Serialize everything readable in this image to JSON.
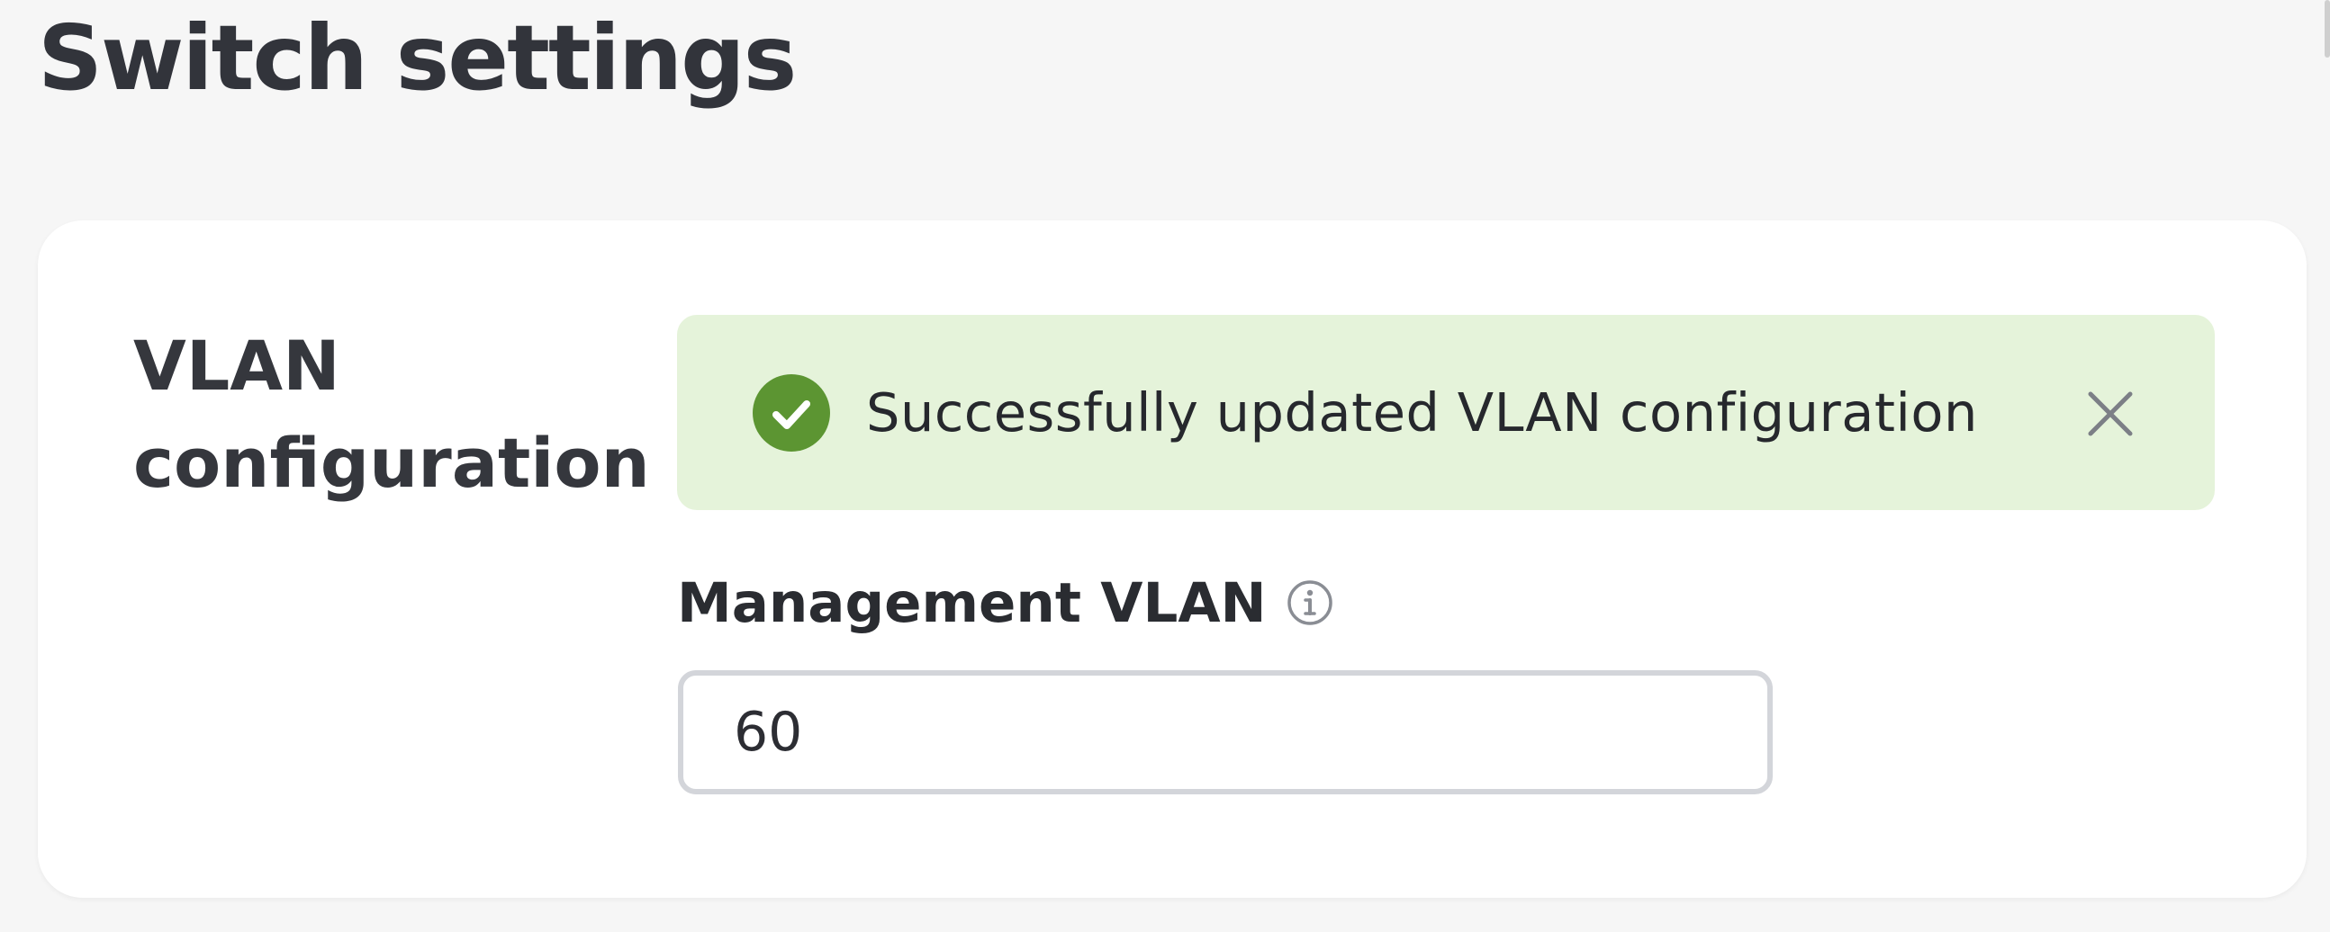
{
  "page": {
    "title": "Switch settings"
  },
  "section": {
    "title": "VLAN configuration"
  },
  "alert": {
    "type": "success",
    "message": "Successfully updated VLAN configuration",
    "icon": "check-circle-icon",
    "dismiss_icon": "close-icon"
  },
  "management_vlan": {
    "label": "Management VLAN",
    "info_icon": "info-icon",
    "value": "60"
  },
  "colors": {
    "background": "#f6f6f6",
    "card": "#ffffff",
    "alert_background": "#e5f3da",
    "success_green": "#5c9532",
    "input_border": "#d3d5da",
    "text_dark": "#32343b",
    "icon_gray": "#7c7f86"
  }
}
